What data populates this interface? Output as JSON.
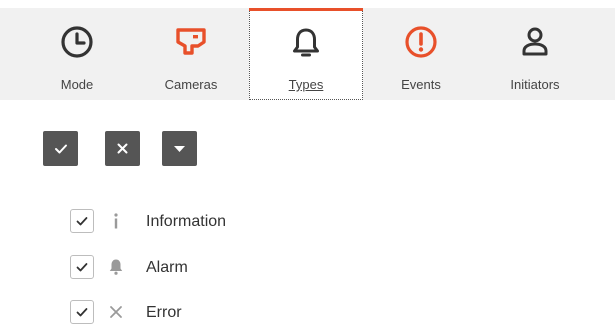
{
  "colors": {
    "accent": "#e8502a",
    "icon_dark": "#333333",
    "button_bg": "#555555",
    "tabbar_bg": "#f1f1f1"
  },
  "tabs": [
    {
      "label": "Mode",
      "icon": "clock-icon",
      "active": false
    },
    {
      "label": "Cameras",
      "icon": "camera-icon",
      "active": false
    },
    {
      "label": "Types",
      "icon": "bell-icon",
      "active": true
    },
    {
      "label": "Events",
      "icon": "exclamation-circle-icon",
      "active": false
    },
    {
      "label": "Initiators",
      "icon": "person-icon",
      "active": false
    }
  ],
  "actions": [
    {
      "icon": "check-icon"
    },
    {
      "icon": "close-icon"
    },
    {
      "icon": "caret-down-icon"
    }
  ],
  "types": [
    {
      "label": "Information",
      "icon": "info-icon",
      "checked": true
    },
    {
      "label": "Alarm",
      "icon": "bell-icon",
      "checked": true
    },
    {
      "label": "Error",
      "icon": "x-icon",
      "checked": true
    }
  ]
}
